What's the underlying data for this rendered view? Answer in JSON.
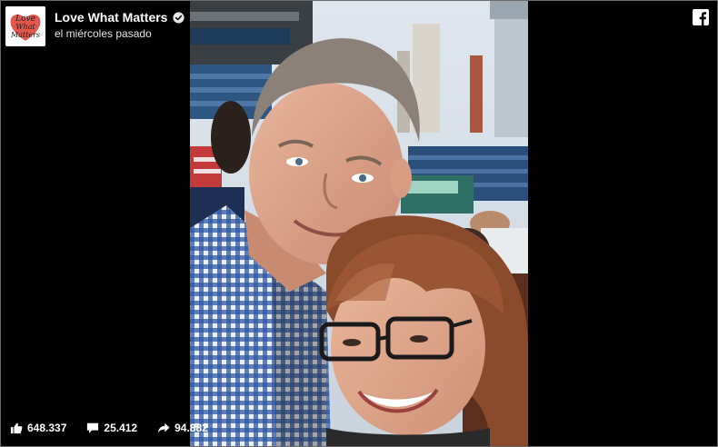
{
  "page": {
    "name": "Love What Matters",
    "timestamp": "el miércoles pasado",
    "avatar_text": [
      "Love",
      "What",
      "Matters"
    ],
    "verified": true
  },
  "stats": {
    "likes": "648.337",
    "comments": "25.412",
    "shares": "94.882"
  },
  "icons": {
    "like": "thumbs-up-icon",
    "comment": "comment-icon",
    "share": "share-icon",
    "brand": "facebook-icon",
    "verified": "verified-badge-icon"
  },
  "colors": {
    "background": "#000000",
    "text": "#ffffff",
    "logo_heart": "#e2574c"
  }
}
